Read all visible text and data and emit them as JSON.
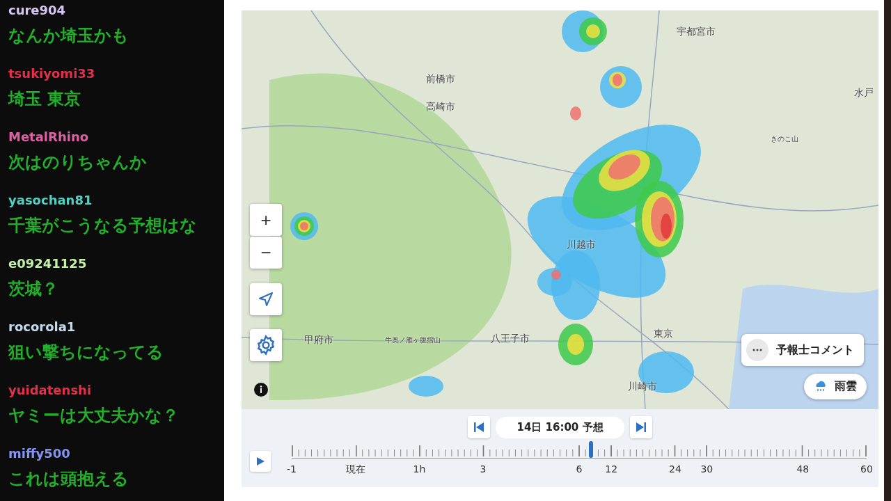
{
  "chat": [
    {
      "user": "cure904",
      "color": "#d6c6f2",
      "message": "なんか埼玉かも"
    },
    {
      "user": "tsukiyomi33",
      "color": "#e0304c",
      "message": "埼玉 東京"
    },
    {
      "user": "MetalRhino",
      "color": "#e060a6",
      "message": "次はのりちゃんか"
    },
    {
      "user": "yasochan81",
      "color": "#4fd0c0",
      "message": "千葉がこうなる予想はな"
    },
    {
      "user": "e09241125",
      "color": "#c6efa8",
      "message": "茨城？"
    },
    {
      "user": "rocorola1",
      "color": "#c4dcf0",
      "message": "狙い撃ちになってる"
    },
    {
      "user": "yuidatenshi",
      "color": "#e0304c",
      "message": "ヤミーは大丈夫かな？"
    },
    {
      "user": "miffy500",
      "color": "#8494f2",
      "message": "これは頭抱える"
    }
  ],
  "map": {
    "labels": [
      "宇都宮市",
      "前橋市",
      "高崎市",
      "水戸",
      "きのこ山",
      "川越市",
      "甲府市",
      "牛奥ノ雁ヶ腹摺山",
      "八王子市",
      "東京",
      "川崎市"
    ],
    "zoom_in": "+",
    "zoom_out": "−",
    "comment_button": "予報士コメント",
    "layer_button": "雨雲"
  },
  "timeline": {
    "time_label": "14日 16:00 予想",
    "playing": false,
    "level": 0.52,
    "ticks": [
      "-1",
      "現在",
      "1h",
      "3",
      "6",
      "12",
      "24",
      "30",
      "48",
      "60"
    ]
  }
}
